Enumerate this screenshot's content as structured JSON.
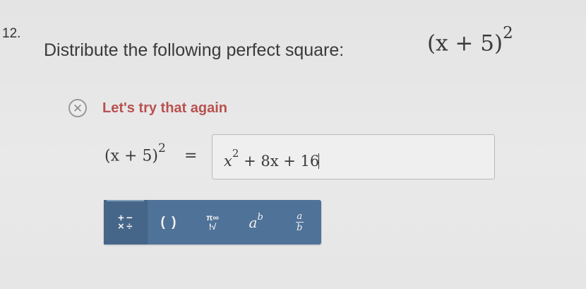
{
  "question": {
    "number": "12.",
    "prompt": "Distribute the following perfect square:",
    "expression": "(x + 5)",
    "exponent": "2"
  },
  "feedback": {
    "icon": "x-circle-icon",
    "text": "Let's try that again",
    "color": "#b9514f"
  },
  "equation": {
    "lhs": "(x + 5)",
    "lhs_exponent": "2",
    "equals": "=",
    "answer_x": "x",
    "answer_exponent": "2",
    "answer_rest": " + 8x + 16"
  },
  "toolbar": {
    "accent": "#4f7298",
    "tools": [
      {
        "name": "operators",
        "icon": "operators-icon",
        "glyphs": [
          "+",
          "−",
          "×",
          "÷"
        ]
      },
      {
        "name": "parentheses",
        "icon": "parentheses-icon",
        "label": "( )"
      },
      {
        "name": "symbols",
        "icon": "pi-infinity-root-icon",
        "top": "π∞",
        "bottom": "!√"
      },
      {
        "name": "exponent",
        "icon": "exponent-icon",
        "base": "a",
        "exp": "b"
      },
      {
        "name": "fraction",
        "icon": "fraction-icon",
        "num": "a",
        "den": "b"
      }
    ]
  }
}
